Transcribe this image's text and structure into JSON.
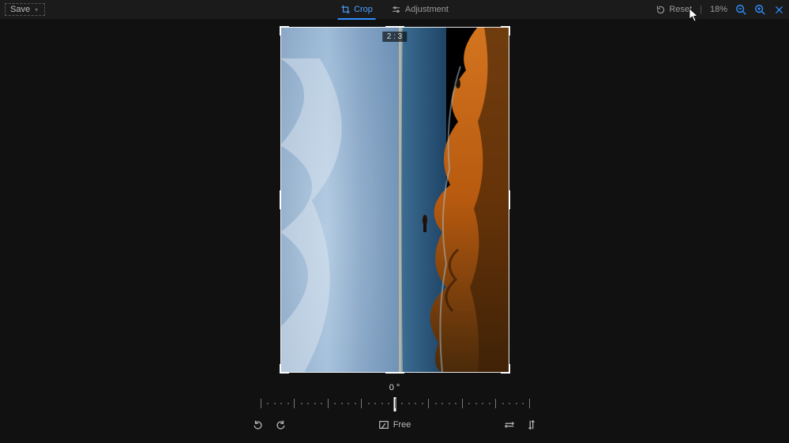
{
  "topbar": {
    "save_label": "Save",
    "tabs": {
      "crop": "Crop",
      "adjustment": "Adjustment",
      "active": "crop"
    },
    "reset_label": "Reset",
    "zoom_label": "18%"
  },
  "crop": {
    "ratio_badge": "2 : 3",
    "angle_label": "0 °"
  },
  "bottom": {
    "aspect_mode_label": "Free"
  }
}
